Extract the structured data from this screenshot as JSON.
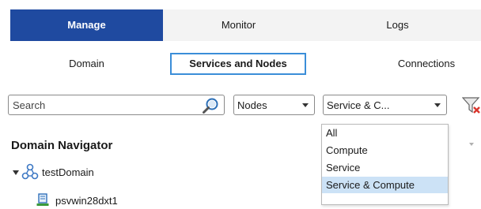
{
  "top_tabs": [
    {
      "label": "Manage",
      "active": true
    },
    {
      "label": "Monitor",
      "active": false
    },
    {
      "label": "Logs",
      "active": false
    }
  ],
  "sub_tabs": [
    {
      "label": "Domain",
      "active": false
    },
    {
      "label": "Services and Nodes",
      "active": true
    },
    {
      "label": "Connections",
      "active": false
    }
  ],
  "toolbar": {
    "search_placeholder": "Search",
    "type_select": "Nodes",
    "category_select": "Service & C..."
  },
  "dropdown": {
    "options": [
      "All",
      "Compute",
      "Service",
      "Service & Compute"
    ],
    "selected": "Service & Compute"
  },
  "navigator": {
    "title": "Domain Navigator",
    "domain": "testDomain",
    "nodes": [
      "psvwin28dxt1"
    ]
  },
  "colors": {
    "accent": "#1f4aa0",
    "tab_focus_border": "#3b8ed8",
    "dropdown_selected": "#cce2f6",
    "clear_filter_x": "#d9342b"
  }
}
